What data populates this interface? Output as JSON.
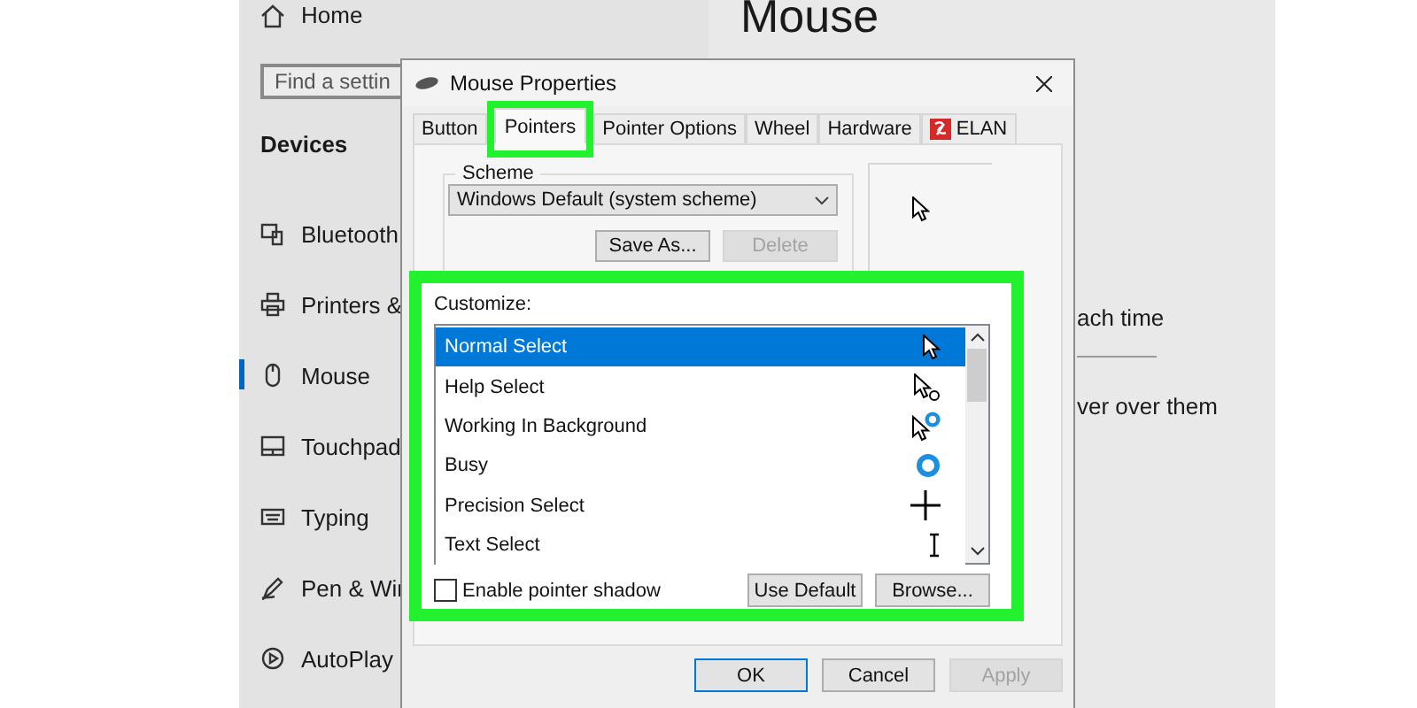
{
  "settings_window": {
    "home": "Home",
    "search": {
      "placeholder": "Find a settin"
    },
    "section": "Devices",
    "items": [
      {
        "label": "Bluetooth",
        "kind": "devices",
        "selected": false
      },
      {
        "label": "Printers &",
        "kind": "printer",
        "selected": false
      },
      {
        "label": "Mouse",
        "kind": "mouse",
        "selected": true
      },
      {
        "label": "Touchpad",
        "kind": "touchpad",
        "selected": false
      },
      {
        "label": "Typing",
        "kind": "keyboard",
        "selected": false
      },
      {
        "label": "Pen & Wir",
        "kind": "pen",
        "selected": false
      },
      {
        "label": "AutoPlay",
        "kind": "autoplay",
        "selected": false
      }
    ],
    "page": {
      "title": "Mouse",
      "texts": [
        "ach time",
        "ver over them"
      ]
    }
  },
  "dialog": {
    "title": "Mouse Properties",
    "tabs": [
      {
        "label": "Button",
        "selected": false,
        "highlighted": false
      },
      {
        "label": "Pointers",
        "selected": true,
        "highlighted": true
      },
      {
        "label": "Pointer Options",
        "selected": false,
        "highlighted": false
      },
      {
        "label": "Wheel",
        "selected": false,
        "highlighted": false
      },
      {
        "label": "Hardware",
        "selected": false,
        "highlighted": false
      },
      {
        "label": "ELAN",
        "selected": false,
        "highlighted": false,
        "kind": "elan"
      }
    ],
    "scheme": {
      "label": "Scheme",
      "value": "Windows Default (system scheme)",
      "buttons": [
        {
          "label": "Save As...",
          "disabled": false
        },
        {
          "label": "Delete",
          "disabled": true
        }
      ]
    },
    "customize": {
      "highlighted": true,
      "label": "Customize:",
      "rows": [
        {
          "label": "Normal Select",
          "kind": "arrow",
          "selected": true
        },
        {
          "label": "Help Select",
          "kind": "help",
          "selected": false
        },
        {
          "label": "Working In Background",
          "kind": "working",
          "selected": false
        },
        {
          "label": "Busy",
          "kind": "busy",
          "selected": false
        },
        {
          "label": "Precision Select",
          "kind": "cross",
          "selected": false
        },
        {
          "label": "Text Select",
          "kind": "ibeam",
          "selected": false
        }
      ],
      "shadow": {
        "label": "Enable pointer shadow",
        "checked": false
      },
      "buttons": [
        "Use Default",
        "Browse..."
      ]
    },
    "footer": [
      {
        "label": "OK",
        "disabled": false,
        "default": true
      },
      {
        "label": "Cancel",
        "disabled": false,
        "default": false
      },
      {
        "label": "Apply",
        "disabled": true,
        "default": false
      }
    ]
  }
}
